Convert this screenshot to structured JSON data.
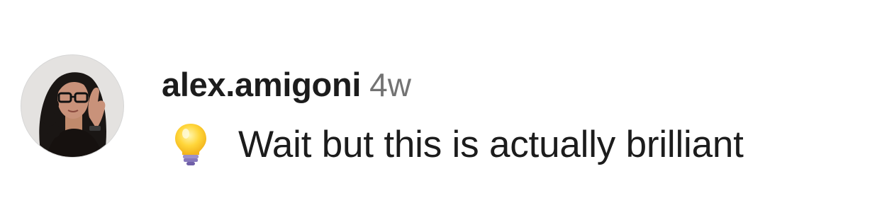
{
  "comment": {
    "username": "alex.amigoni",
    "timestamp": "4w",
    "emoji": "light-bulb-icon",
    "text": "Wait but this is actually brilliant"
  },
  "colors": {
    "username": "#1c1c1c",
    "timestamp": "#737373",
    "text": "#1c1c1c",
    "background": "#ffffff"
  }
}
